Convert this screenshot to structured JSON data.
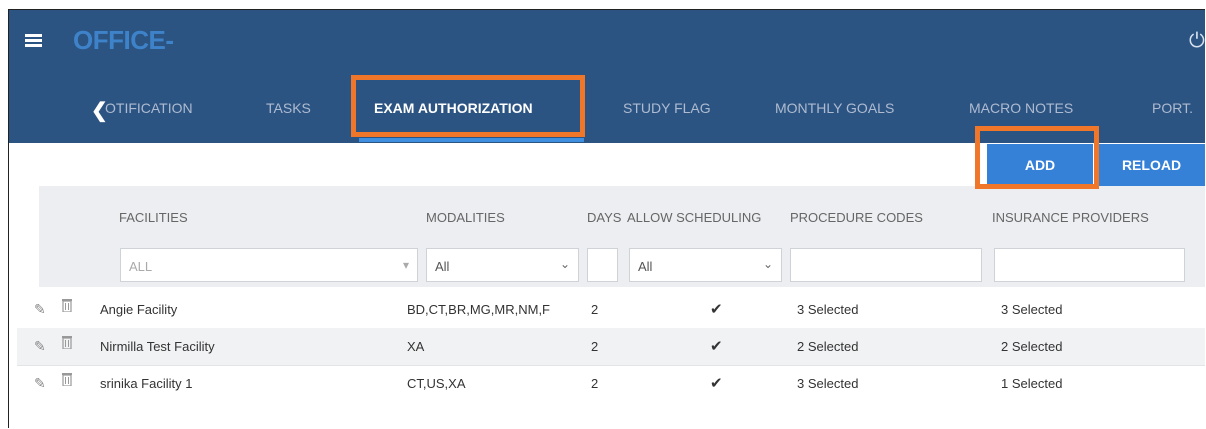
{
  "app": {
    "title": "OFFICE",
    "title_suffix": "-"
  },
  "tabs": [
    {
      "label": "OTIFICATION"
    },
    {
      "label": "TASKS"
    },
    {
      "label": "EXAM AUTHORIZATION"
    },
    {
      "label": "STUDY FLAG"
    },
    {
      "label": "MONTHLY GOALS"
    },
    {
      "label": "MACRO NOTES"
    },
    {
      "label": "PORT."
    }
  ],
  "toolbar": {
    "add_label": "ADD",
    "reload_label": "RELOAD"
  },
  "table": {
    "headers": {
      "facilities": "FACILITIES",
      "modalities": "MODALITIES",
      "days": "DAYS",
      "allow_scheduling": "ALLOW SCHEDULING",
      "procedure_codes": "PROCEDURE CODES",
      "insurance_providers": "INSURANCE PROVIDERS"
    },
    "filters": {
      "facilities": "ALL",
      "modalities": "All",
      "allow_scheduling": "All"
    },
    "rows": [
      {
        "facility": "Angie Facility",
        "modalities": "BD,CT,BR,MG,MR,NM,F",
        "days": "2",
        "allow": "✔",
        "procedure_codes": "3 Selected",
        "insurance": "3 Selected"
      },
      {
        "facility": "Nirmilla Test Facility",
        "modalities": "XA",
        "days": "2",
        "allow": "✔",
        "procedure_codes": "2 Selected",
        "insurance": "2 Selected"
      },
      {
        "facility": "srinika Facility 1",
        "modalities": "CT,US,XA",
        "days": "2",
        "allow": "✔",
        "procedure_codes": "3 Selected",
        "insurance": "1 Selected"
      }
    ]
  }
}
